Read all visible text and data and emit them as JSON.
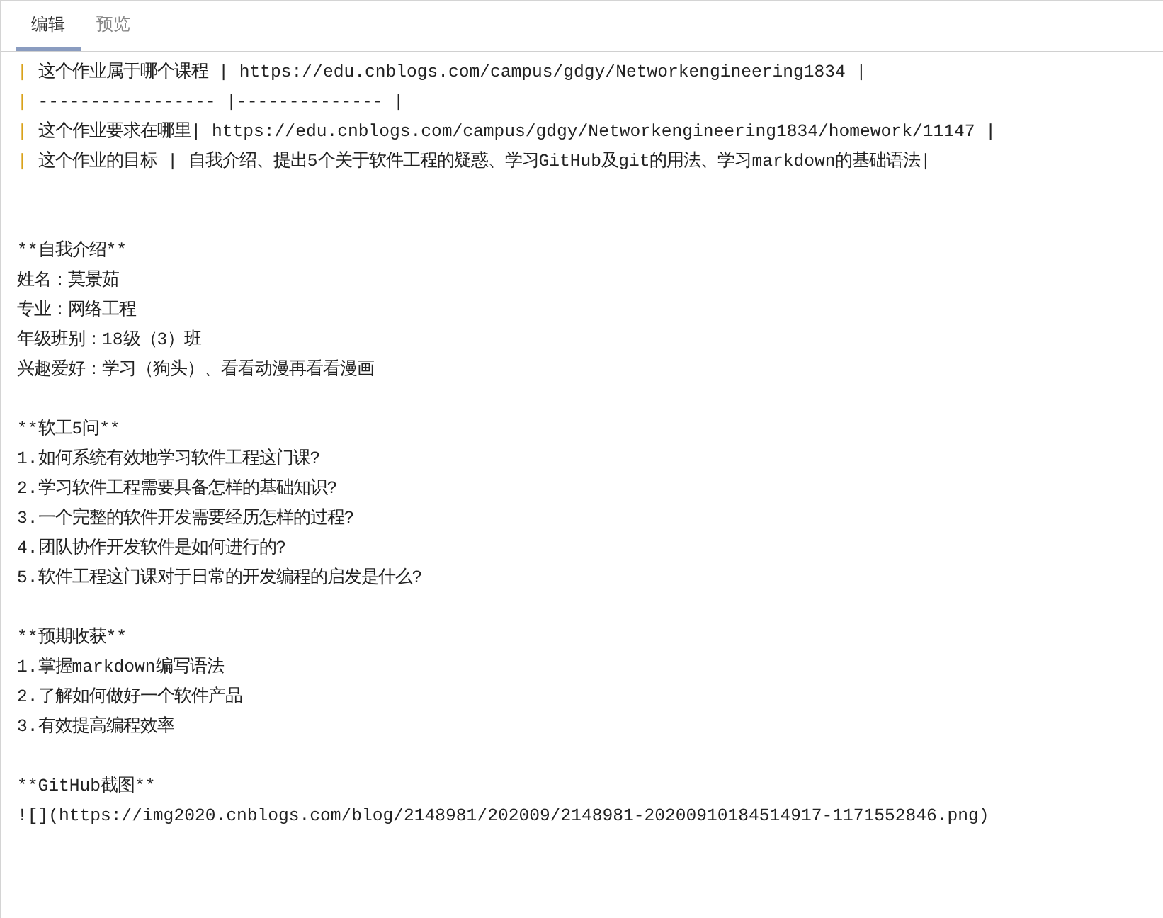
{
  "tabs": [
    {
      "label": "编辑",
      "selected": true
    },
    {
      "label": "预览",
      "selected": false
    }
  ],
  "editor": {
    "lines": [
      {
        "kind": "table_row",
        "marker": "|",
        "text": " 这个作业属于哪个课程 | https://edu.cnblogs.com/campus/gdgy/Networkengineering1834 |"
      },
      {
        "kind": "table_row",
        "marker": "|",
        "text": " ----------------- |-------------- |"
      },
      {
        "kind": "table_row",
        "marker": "|",
        "text": " 这个作业要求在哪里| https://edu.cnblogs.com/campus/gdgy/Networkengineering1834/homework/11147 |"
      },
      {
        "kind": "table_row",
        "marker": "|",
        "text": " 这个作业的目标 | 自我介绍、提出5个关于软件工程的疑惑、学习GitHub及git的用法、学习markdown的基础语法|"
      },
      {
        "kind": "blank"
      },
      {
        "kind": "blank"
      },
      {
        "kind": "text",
        "text": "**自我介绍**"
      },
      {
        "kind": "text",
        "text": "姓名：莫景茹"
      },
      {
        "kind": "text",
        "text": "专业：网络工程"
      },
      {
        "kind": "text",
        "text": "年级班别：18级（3）班"
      },
      {
        "kind": "text",
        "text": "兴趣爱好：学习（狗头）、看看动漫再看看漫画"
      },
      {
        "kind": "blank"
      },
      {
        "kind": "text",
        "text": "**软工5问**"
      },
      {
        "kind": "text",
        "text": "1.如何系统有效地学习软件工程这门课?"
      },
      {
        "kind": "text",
        "text": "2.学习软件工程需要具备怎样的基础知识?"
      },
      {
        "kind": "text",
        "text": "3.一个完整的软件开发需要经历怎样的过程?"
      },
      {
        "kind": "text",
        "text": "4.团队协作开发软件是如何进行的?"
      },
      {
        "kind": "text",
        "text": "5.软件工程这门课对于日常的开发编程的启发是什么?"
      },
      {
        "kind": "blank"
      },
      {
        "kind": "text",
        "text": "**预期收获**"
      },
      {
        "kind": "text",
        "text": "1.掌握markdown编写语法"
      },
      {
        "kind": "text",
        "text": "2.了解如何做好一个软件产品"
      },
      {
        "kind": "text",
        "text": "3.有效提高编程效率"
      },
      {
        "kind": "blank"
      },
      {
        "kind": "text",
        "text": "**GitHub截图**"
      },
      {
        "kind": "text",
        "text": "![](https://img2020.cnblogs.com/blog/2148981/202009/2148981-20200910184514917-1171552846.png)"
      }
    ]
  }
}
